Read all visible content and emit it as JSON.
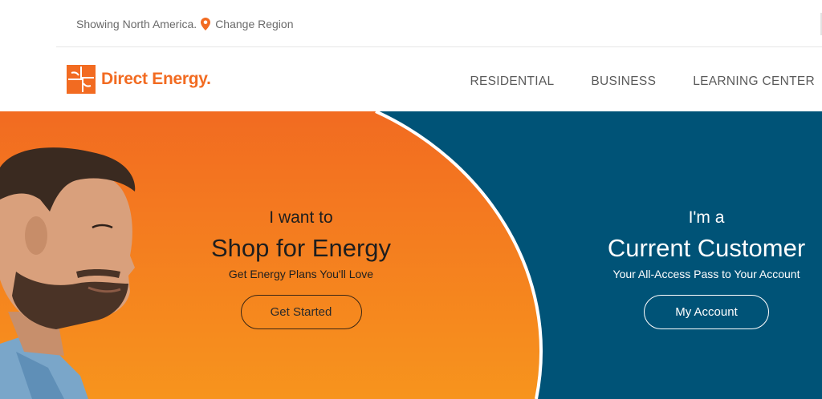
{
  "region": {
    "showing_text": "Showing North America.",
    "change_label": "Change Region",
    "pin_icon": "location-pin-icon"
  },
  "header": {
    "brand": "Direct Energy.",
    "nav": [
      {
        "label": "RESIDENTIAL"
      },
      {
        "label": "BUSINESS"
      },
      {
        "label": "LEARNING CENTER"
      }
    ]
  },
  "hero": {
    "shop": {
      "pre": "I want to",
      "title": "Shop for Energy",
      "subtitle": "Get Energy Plans You'll Love",
      "button": "Get Started"
    },
    "current": {
      "pre": "I'm a",
      "title": "Current Customer",
      "subtitle": "Your All-Access Pass to Your Account",
      "button": "My Account"
    }
  },
  "colors": {
    "brand_orange": "#f26b21",
    "orange_light": "#f7941d",
    "teal": "#005377",
    "nav_text": "#5a5a5a"
  }
}
